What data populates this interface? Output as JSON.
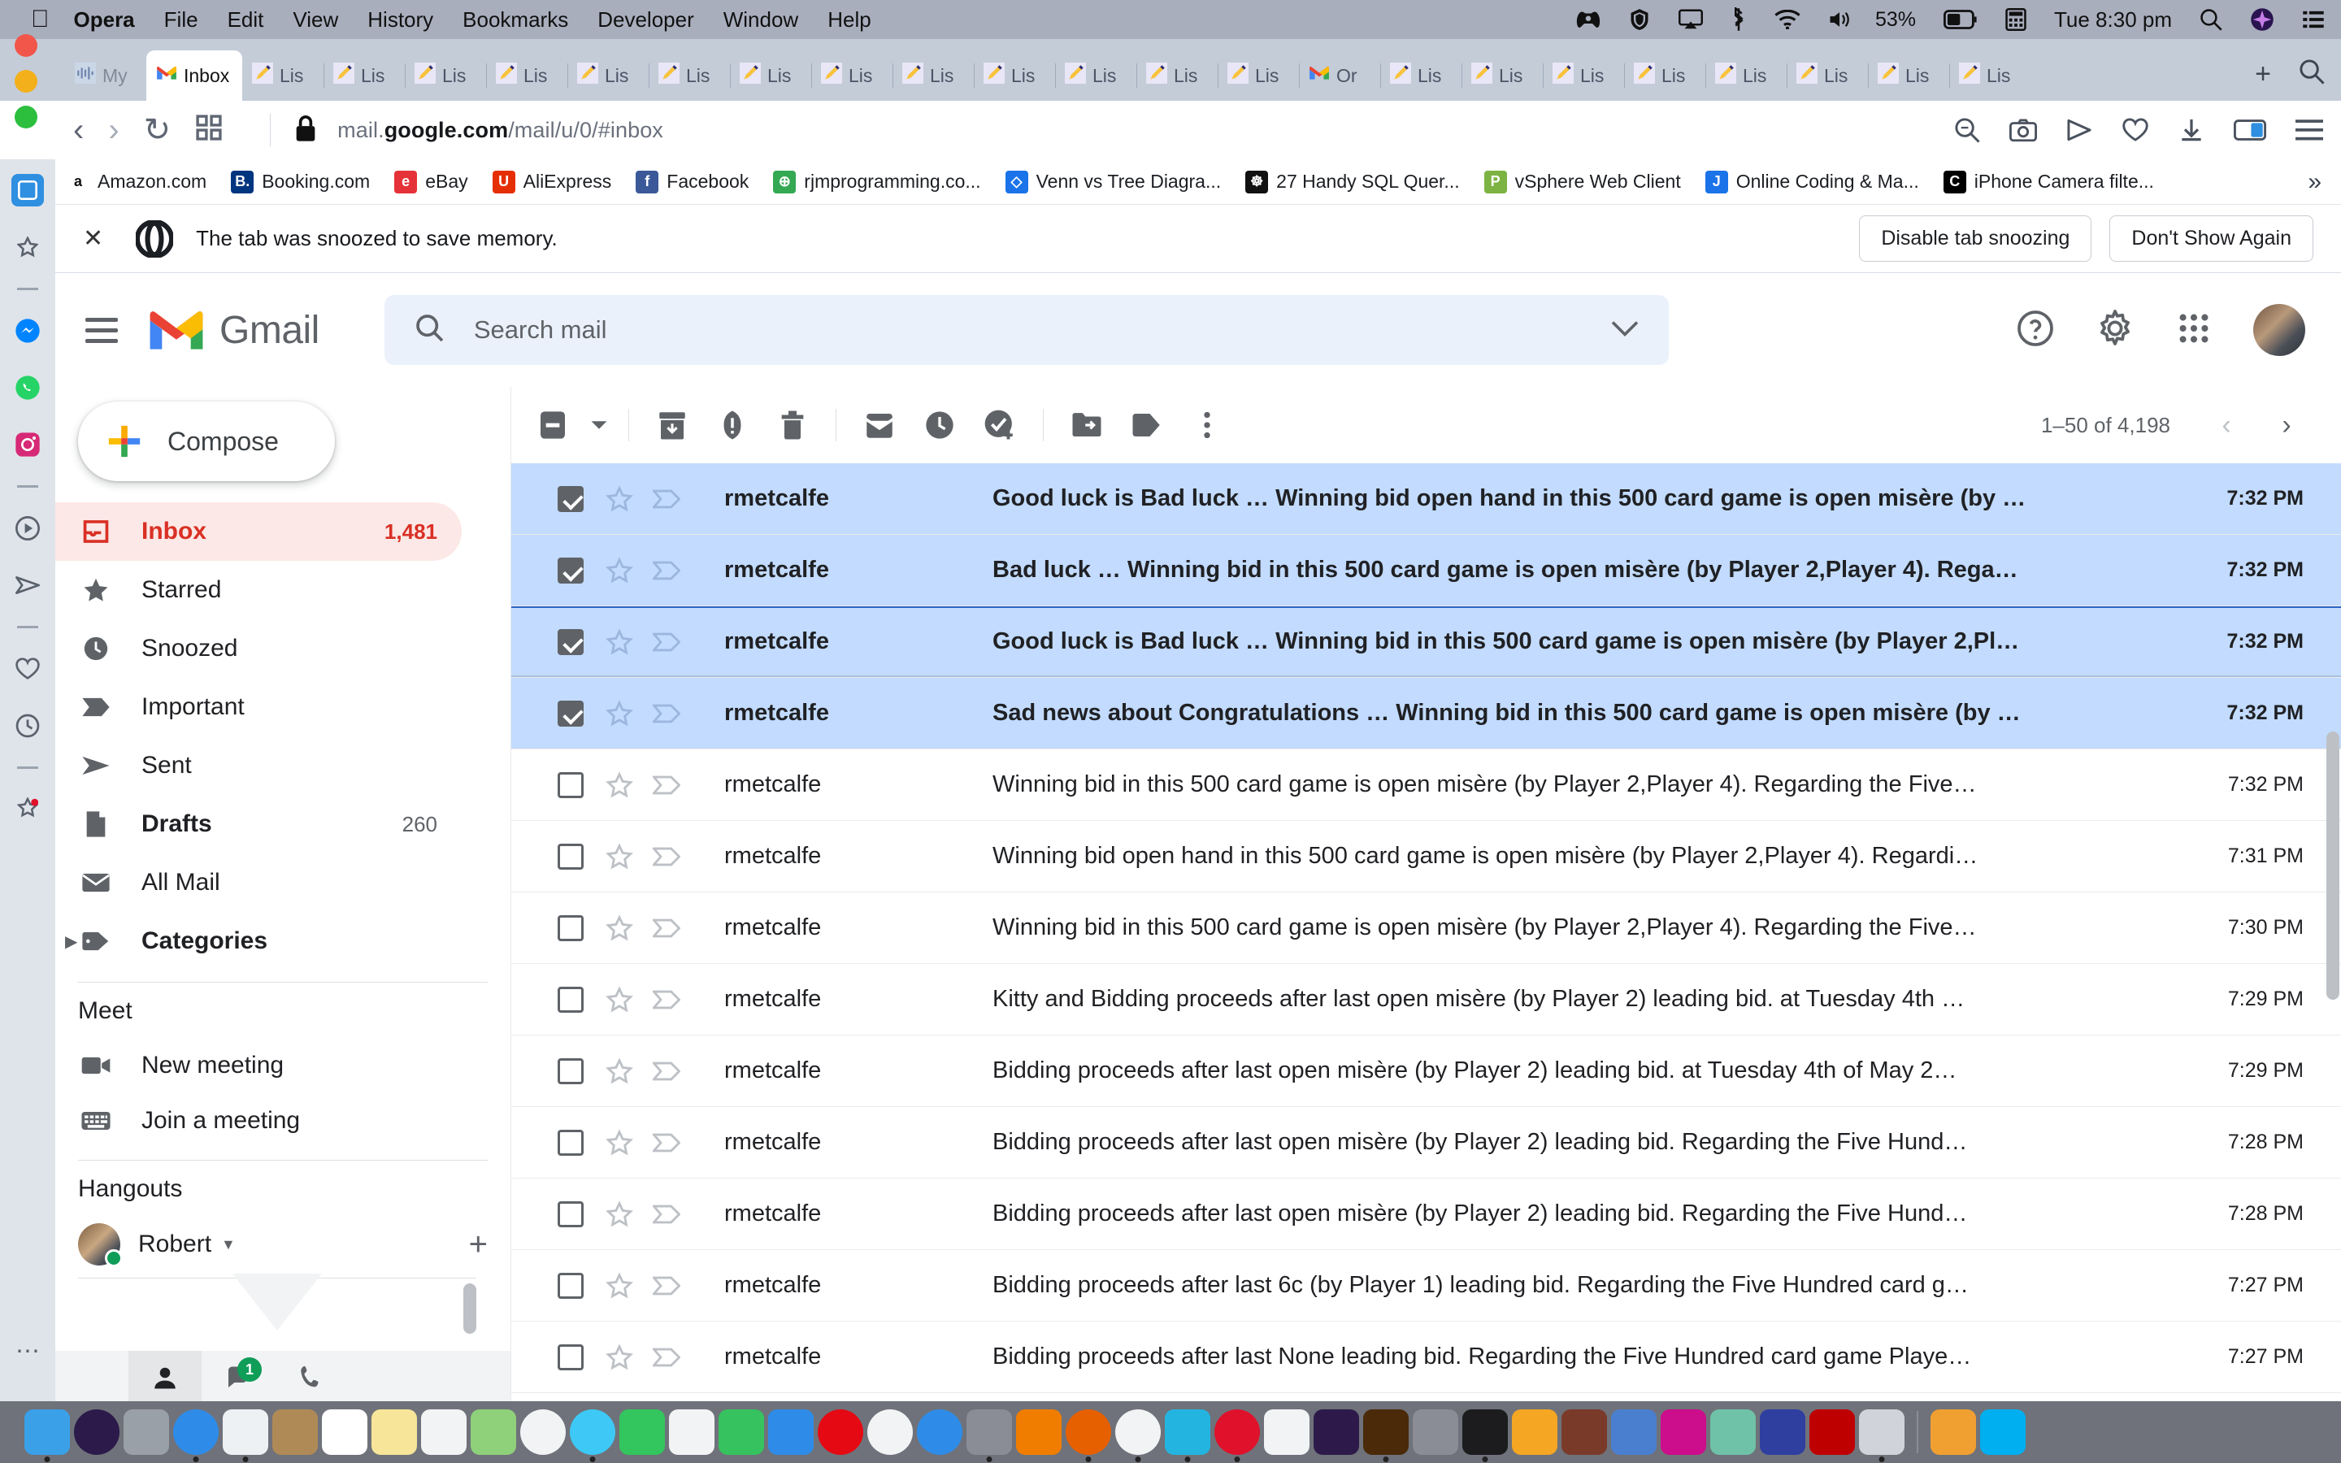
{
  "os_menubar": {
    "apple_icon": "apple-icon",
    "app_name": "Opera",
    "menus": [
      "File",
      "Edit",
      "View",
      "History",
      "Bookmarks",
      "Developer",
      "Window",
      "Help"
    ],
    "status_icons": [
      "xbox-controller-icon",
      "malwarebytes-icon",
      "airplay-icon",
      "bluetooth-icon",
      "wifi-icon",
      "volume-icon"
    ],
    "battery_percent": "53%",
    "datetime": "Tue 8:30 pm",
    "spotlight_icon": "search-icon",
    "siri_icon": "siri-icon",
    "controlcenter_icon": "list-icon"
  },
  "browser": {
    "traffic_lights": [
      "close",
      "minimize",
      "zoom"
    ],
    "tabs": [
      {
        "label": "My",
        "icon": "audio-icon",
        "active": false
      },
      {
        "label": "Inbox",
        "icon": "gmail-icon",
        "active": true
      },
      {
        "label": "Lis",
        "icon": "pencil-icon",
        "active": false
      },
      {
        "label": "Lis",
        "icon": "pencil-icon",
        "active": false
      },
      {
        "label": "Lis",
        "icon": "pencil-icon",
        "active": false
      },
      {
        "label": "Lis",
        "icon": "pencil-icon",
        "active": false
      },
      {
        "label": "Lis",
        "icon": "pencil-icon",
        "active": false
      },
      {
        "label": "Lis",
        "icon": "pencil-icon",
        "active": false
      },
      {
        "label": "Lis",
        "icon": "pencil-icon",
        "active": false
      },
      {
        "label": "Lis",
        "icon": "pencil-icon",
        "active": false
      },
      {
        "label": "Lis",
        "icon": "pencil-icon",
        "active": false
      },
      {
        "label": "Lis",
        "icon": "pencil-icon",
        "active": false
      },
      {
        "label": "Lis",
        "icon": "pencil-icon",
        "active": false
      },
      {
        "label": "Lis",
        "icon": "pencil-icon",
        "active": false
      },
      {
        "label": "Lis",
        "icon": "pencil-icon",
        "active": false
      },
      {
        "label": "Or",
        "icon": "gmail-icon",
        "active": false
      },
      {
        "label": "Lis",
        "icon": "pencil-icon",
        "active": false
      },
      {
        "label": "Lis",
        "icon": "pencil-icon",
        "active": false
      },
      {
        "label": "Lis",
        "icon": "pencil-icon",
        "active": false
      },
      {
        "label": "Lis",
        "icon": "pencil-icon",
        "active": false
      },
      {
        "label": "Lis",
        "icon": "pencil-icon",
        "active": false
      },
      {
        "label": "Lis",
        "icon": "pencil-icon",
        "active": false
      },
      {
        "label": "Lis",
        "icon": "pencil-icon",
        "active": false
      },
      {
        "label": "Lis",
        "icon": "pencil-icon",
        "active": false
      }
    ],
    "new_tab_label": "+",
    "tab_search_icon": "search-icon",
    "nav": {
      "back_icon": "chevron-left-icon",
      "forward_icon": "chevron-right-icon",
      "reload_icon": "reload-icon",
      "workspace_icon": "grid-icon",
      "lock_icon": "lock-icon"
    },
    "url_prefix": "mail.",
    "url_domain": "google.com",
    "url_suffix": "/mail/u/0/#inbox",
    "right_icons": [
      "search-in-page-icon",
      "snapshot-icon",
      "player-icon",
      "heart-icon",
      "download-icon",
      "sidebar-toggle-icon",
      "menu-icon"
    ],
    "bookmarks": [
      {
        "label": "Amazon.com",
        "icon": "amazon-icon",
        "color": "#ffffff",
        "glyph": "a"
      },
      {
        "label": "Booking.com",
        "icon": "booking-icon",
        "color": "#003580",
        "glyph": "B."
      },
      {
        "label": "eBay",
        "icon": "ebay-icon",
        "color": "#e53238",
        "glyph": "e"
      },
      {
        "label": "AliExpress",
        "icon": "aliexpress-icon",
        "color": "#e62e04",
        "glyph": "U"
      },
      {
        "label": "Facebook",
        "icon": "facebook-icon",
        "color": "#3b5998",
        "glyph": "f"
      },
      {
        "label": "rjmprogramming.co...",
        "icon": "globe-icon",
        "color": "#34a853",
        "glyph": "⊕"
      },
      {
        "label": "Venn vs Tree Diagra...",
        "icon": "blue-diamond-icon",
        "color": "#1a73e8",
        "glyph": "◇"
      },
      {
        "label": "27 Handy SQL Quer...",
        "icon": "dark-icon",
        "color": "#111111",
        "glyph": "☸"
      },
      {
        "label": "vSphere Web Client",
        "icon": "vsphere-icon",
        "color": "#7cb342",
        "glyph": "P"
      },
      {
        "label": "Online Coding & Ma...",
        "icon": "blue-circle-icon",
        "color": "#1a73e8",
        "glyph": "J"
      },
      {
        "label": "iPhone Camera filte...",
        "icon": "black-circle-icon",
        "color": "#000000",
        "glyph": "C"
      }
    ],
    "bookmarks_overflow": "»",
    "sidebar_icons": [
      "workspace-icon",
      "bookmarks-icon",
      "divider",
      "messenger-icon",
      "whatsapp-icon",
      "instagram-icon",
      "divider",
      "player-icon",
      "telegram-icon",
      "divider",
      "favorites-icon",
      "history-icon",
      "divider",
      "pinboard-icon",
      "more-icon"
    ]
  },
  "notification": {
    "close_icon": "close-icon",
    "brand_icon": "opera-icon",
    "message": "The tab was snoozed to save memory.",
    "primary_button": "Disable tab snoozing",
    "secondary_button": "Don't Show Again"
  },
  "gmail": {
    "menu_icon": "hamburger-icon",
    "logo_icon": "gmail-m-icon",
    "wordmark": "Gmail",
    "search": {
      "icon": "search-icon",
      "placeholder": "Search mail",
      "value": "",
      "options_icon": "chevron-down-icon"
    },
    "header_icons": [
      "help-icon",
      "settings-gear-icon",
      "apps-grid-icon",
      "account-avatar"
    ],
    "sidebar": {
      "compose_label": "Compose",
      "compose_icon": "plus-icon",
      "items": [
        {
          "label": "Inbox",
          "icon": "inbox-icon",
          "count": "1,481",
          "active": true,
          "bold": true
        },
        {
          "label": "Starred",
          "icon": "star-icon",
          "count": "",
          "active": false,
          "bold": false
        },
        {
          "label": "Snoozed",
          "icon": "clock-icon",
          "count": "",
          "active": false,
          "bold": false
        },
        {
          "label": "Important",
          "icon": "label-important-icon",
          "count": "",
          "active": false,
          "bold": false
        },
        {
          "label": "Sent",
          "icon": "send-icon",
          "count": "",
          "active": false,
          "bold": false
        },
        {
          "label": "Drafts",
          "icon": "draft-icon",
          "count": "260",
          "active": false,
          "bold": true
        },
        {
          "label": "All Mail",
          "icon": "mail-icon",
          "count": "",
          "active": false,
          "bold": false
        },
        {
          "label": "Categories",
          "icon": "tag-icon",
          "count": "",
          "active": false,
          "bold": true,
          "expandable": true
        }
      ],
      "meet": {
        "title": "Meet",
        "items": [
          {
            "label": "New meeting",
            "icon": "video-camera-icon"
          },
          {
            "label": "Join a meeting",
            "icon": "keyboard-icon"
          }
        ]
      },
      "hangouts": {
        "title": "Hangouts",
        "user": "Robert",
        "status": "online",
        "caret_icon": "caret-down-icon",
        "add_icon": "plus-icon",
        "tabs": [
          {
            "icon": "contacts-icon",
            "selected": true,
            "badge": ""
          },
          {
            "icon": "chat-icon",
            "selected": false,
            "badge": "1"
          },
          {
            "icon": "phone-icon",
            "selected": false,
            "badge": ""
          }
        ]
      }
    },
    "toolbar": {
      "select_all_icon": "checkbox-icon",
      "select_caret_icon": "caret-down-icon",
      "buttons": [
        {
          "icon": "archive-icon",
          "name": "archive"
        },
        {
          "icon": "report-spam-icon",
          "name": "report-spam"
        },
        {
          "icon": "delete-icon",
          "name": "delete"
        },
        {
          "icon": "mark-unread-icon",
          "name": "mark-as-unread"
        },
        {
          "icon": "snooze-clock-icon",
          "name": "snooze"
        },
        {
          "icon": "add-to-tasks-icon",
          "name": "add-to-tasks"
        },
        {
          "icon": "move-to-icon",
          "name": "move-to"
        },
        {
          "icon": "labels-tag-icon",
          "name": "labels"
        },
        {
          "icon": "more-vertical-icon",
          "name": "more"
        }
      ],
      "pagination": {
        "range": "1–50 of 4,198",
        "prev_icon": "chevron-left-icon",
        "next_icon": "chevron-right-icon"
      }
    },
    "messages": [
      {
        "sender": "rmetcalfe",
        "subject": "Good luck is Bad luck … Winning bid open hand in this 500 card game is open misère (by …",
        "time": "7:32 PM",
        "selected": true,
        "checked": true,
        "focused": false
      },
      {
        "sender": "rmetcalfe",
        "subject": "Bad luck … Winning bid in this 500 card game is open misère (by Player 2,Player 4). Rega…",
        "time": "7:32 PM",
        "selected": true,
        "checked": true,
        "focused": false
      },
      {
        "sender": "rmetcalfe",
        "subject": "Good luck is Bad luck … Winning bid in this 500 card game is open misère (by Player 2,Pl…",
        "time": "7:32 PM",
        "selected": true,
        "checked": true,
        "focused": true
      },
      {
        "sender": "rmetcalfe",
        "subject": "Sad news about Congratulations … Winning bid in this 500 card game is open misère (by …",
        "time": "7:32 PM",
        "selected": true,
        "checked": true,
        "focused": false
      },
      {
        "sender": "rmetcalfe",
        "subject": "Winning bid in this 500 card game is open misère (by Player 2,Player 4). Regarding the Five…",
        "time": "7:32 PM",
        "selected": false,
        "checked": false,
        "focused": false
      },
      {
        "sender": "rmetcalfe",
        "subject": "Winning bid open hand in this 500 card game is open misère (by Player 2,Player 4). Regardi…",
        "time": "7:31 PM",
        "selected": false,
        "checked": false,
        "focused": false
      },
      {
        "sender": "rmetcalfe",
        "subject": "Winning bid in this 500 card game is open misère (by Player 2,Player 4). Regarding the Five…",
        "time": "7:30 PM",
        "selected": false,
        "checked": false,
        "focused": false
      },
      {
        "sender": "rmetcalfe",
        "subject": "Kitty and Bidding proceeds after last open misère (by Player 2) leading bid. at Tuesday 4th …",
        "time": "7:29 PM",
        "selected": false,
        "checked": false,
        "focused": false
      },
      {
        "sender": "rmetcalfe",
        "subject": "Bidding proceeds after last open misère (by Player 2) leading bid. at Tuesday 4th of May 2…",
        "time": "7:29 PM",
        "selected": false,
        "checked": false,
        "focused": false
      },
      {
        "sender": "rmetcalfe",
        "subject": "Bidding proceeds after last open misère (by Player 2) leading bid. Regarding the Five Hund…",
        "time": "7:28 PM",
        "selected": false,
        "checked": false,
        "focused": false
      },
      {
        "sender": "rmetcalfe",
        "subject": "Bidding proceeds after last open misère (by Player 2) leading bid. Regarding the Five Hund…",
        "time": "7:28 PM",
        "selected": false,
        "checked": false,
        "focused": false
      },
      {
        "sender": "rmetcalfe",
        "subject": "Bidding proceeds after last 6c (by Player 1) leading bid. Regarding the Five Hundred card g…",
        "time": "7:27 PM",
        "selected": false,
        "checked": false,
        "focused": false
      },
      {
        "sender": "rmetcalfe",
        "subject": "Bidding proceeds after last None leading bid. Regarding the Five Hundred card game Playe…",
        "time": "7:27 PM",
        "selected": false,
        "checked": false,
        "focused": false
      }
    ]
  },
  "dock": {
    "items": [
      {
        "name": "finder",
        "color": "#3aa0e8",
        "running": true
      },
      {
        "name": "siri",
        "color": "#2b1a4a",
        "running": false
      },
      {
        "name": "launchpad",
        "color": "#9aa0a8",
        "running": false
      },
      {
        "name": "safari",
        "color": "#2e8ce8",
        "running": true
      },
      {
        "name": "mail",
        "color": "#eef1f4",
        "running": true
      },
      {
        "name": "contacts",
        "color": "#b08a56",
        "running": false
      },
      {
        "name": "calendar",
        "color": "#ffffff",
        "running": false
      },
      {
        "name": "notes",
        "color": "#f7e59a",
        "running": false
      },
      {
        "name": "reminders",
        "color": "#f2f3f5",
        "running": false
      },
      {
        "name": "maps",
        "color": "#8fd07a",
        "running": false
      },
      {
        "name": "photos",
        "color": "#f2f3f5",
        "running": false
      },
      {
        "name": "messages",
        "color": "#3ec8f5",
        "running": true
      },
      {
        "name": "facetime",
        "color": "#33c55e",
        "running": false
      },
      {
        "name": "news",
        "color": "#f2f3f5",
        "running": false
      },
      {
        "name": "numbers",
        "color": "#36c25f",
        "running": false
      },
      {
        "name": "keynote",
        "color": "#2e8ce8",
        "running": false
      },
      {
        "name": "netflix",
        "color": "#e50914",
        "running": false
      },
      {
        "name": "itunes",
        "color": "#f2f3f5",
        "running": false
      },
      {
        "name": "appstore",
        "color": "#2e8ce8",
        "running": false
      },
      {
        "name": "system-preferences",
        "color": "#8a8d95",
        "running": true
      },
      {
        "name": "vlc",
        "color": "#f07d00",
        "running": false
      },
      {
        "name": "firefox",
        "color": "#e66000",
        "running": true
      },
      {
        "name": "chrome",
        "color": "#f2f3f5",
        "running": true
      },
      {
        "name": "opera-gx",
        "color": "#24b4e0",
        "running": true
      },
      {
        "name": "opera",
        "color": "#e0112b",
        "running": true
      },
      {
        "name": "evernote",
        "color": "#f2f3f5",
        "running": false
      },
      {
        "name": "photoshop",
        "color": "#2e1a4a",
        "running": false
      },
      {
        "name": "illustrator",
        "color": "#4a2a08",
        "running": true
      },
      {
        "name": "acorn",
        "color": "#8a8d95",
        "running": false
      },
      {
        "name": "terminal",
        "color": "#1c1c1e",
        "running": true
      },
      {
        "name": "sketch",
        "color": "#f5a623",
        "running": false
      },
      {
        "name": "gimp",
        "color": "#7a3a2a",
        "running": false
      },
      {
        "name": "r-studio",
        "color": "#4a7fd0",
        "running": false
      },
      {
        "name": "adobe-xd",
        "color": "#cc0d8c",
        "running": false
      },
      {
        "name": "settings",
        "color": "#6fc2a8",
        "running": false
      },
      {
        "name": "filemaker",
        "color": "#2e3fa0",
        "running": false
      },
      {
        "name": "filezilla",
        "color": "#bf0000",
        "running": false
      },
      {
        "name": "preview",
        "color": "#d0d4da",
        "running": true
      },
      {
        "name": "audacity",
        "color": "#f0a030",
        "running": false
      },
      {
        "name": "skype",
        "color": "#00aff0",
        "running": false
      }
    ]
  },
  "colors": {
    "gmail_red": "#d93025",
    "selected_row": "#c2dbff",
    "accent_blue": "#1a73e8",
    "menubar": "#a9aebd"
  }
}
